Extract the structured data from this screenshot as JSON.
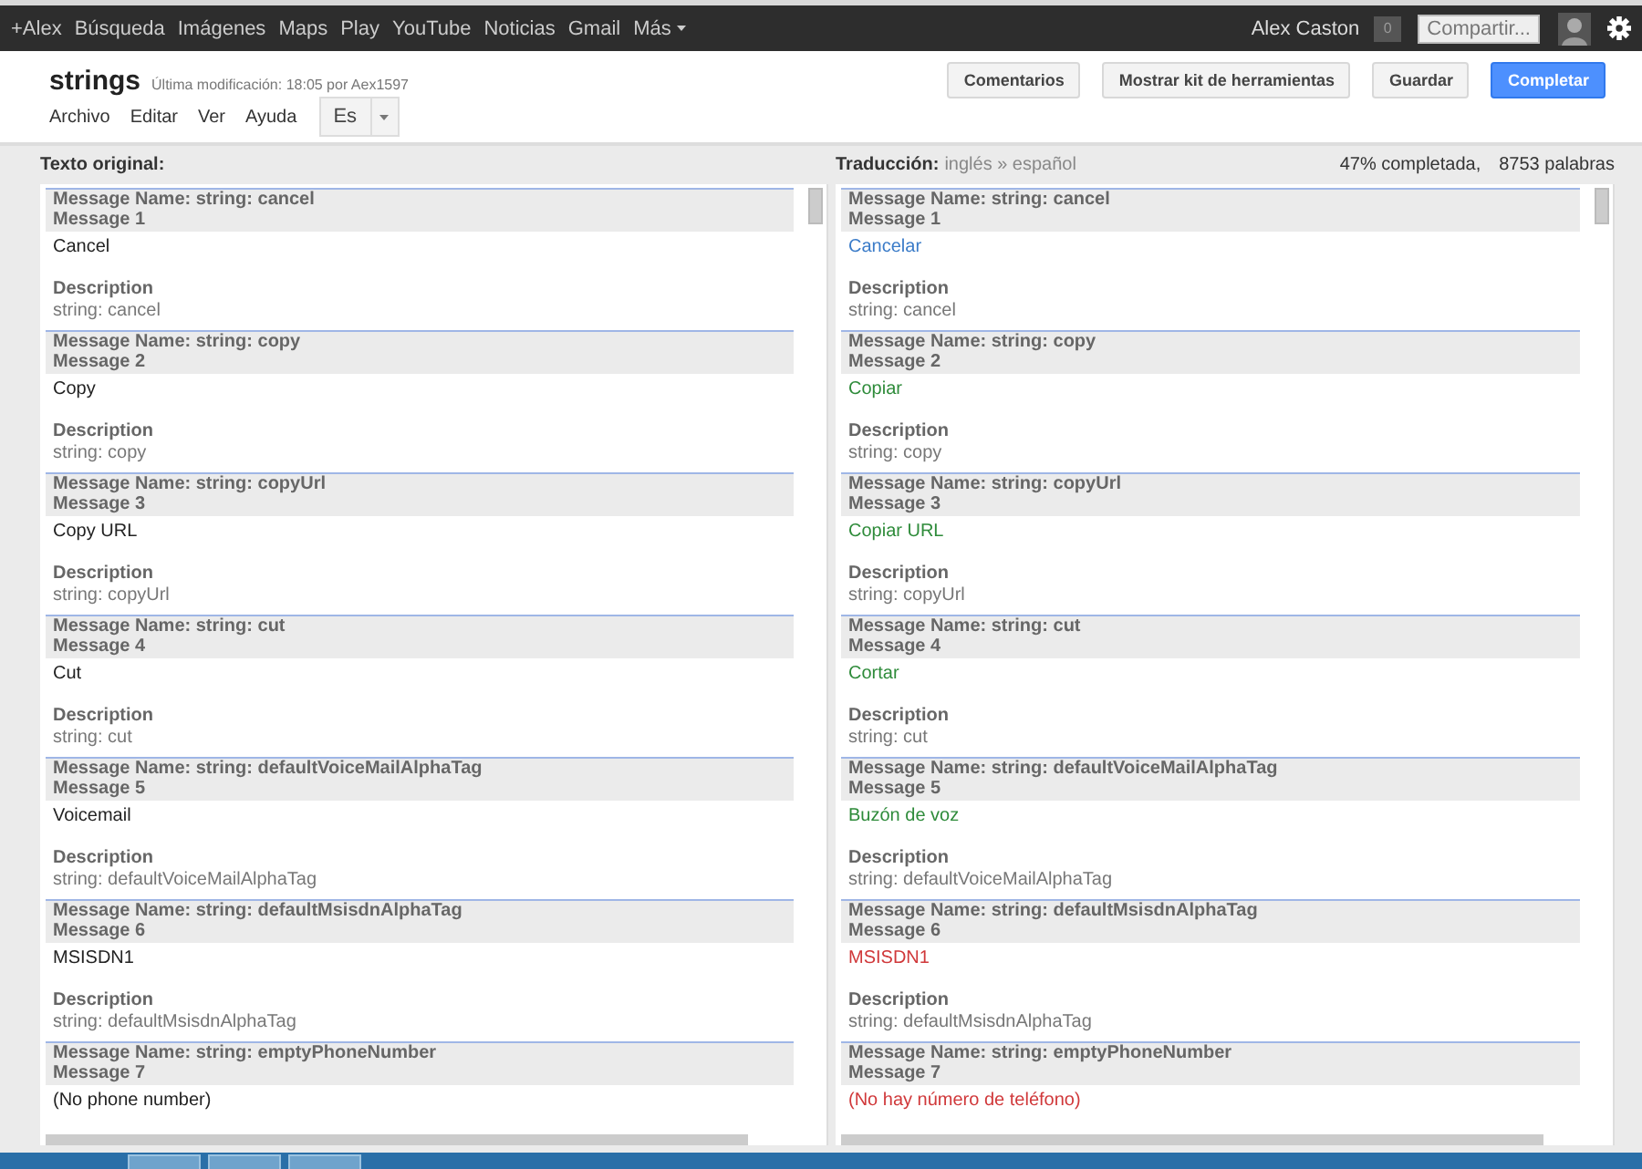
{
  "topbar": {
    "links": [
      "+Alex",
      "Búsqueda",
      "Imágenes",
      "Maps",
      "Play",
      "YouTube",
      "Noticias",
      "Gmail",
      "Más"
    ],
    "user": "Alex Caston",
    "notifications": "0",
    "share": "Compartir..."
  },
  "document": {
    "title": "strings",
    "modified": "Última modificación: 18:05 por Aex1597",
    "menu": [
      "Archivo",
      "Editar",
      "Ver",
      "Ayuda"
    ],
    "language": "Es",
    "buttons": [
      {
        "label": "Comentarios",
        "primary": false
      },
      {
        "label": "Mostrar kit de herramientas",
        "primary": false
      },
      {
        "label": "Guardar",
        "primary": false
      },
      {
        "label": "Completar",
        "primary": true
      }
    ]
  },
  "original": {
    "heading": "Texto original:",
    "messages": [
      {
        "name": "Message Name: string: cancel",
        "number": "Message 1",
        "text": "Cancel",
        "description_label": "Description",
        "description": "string: cancel"
      },
      {
        "name": "Message Name: string: copy",
        "number": "Message 2",
        "text": "Copy",
        "description_label": "Description",
        "description": "string: copy"
      },
      {
        "name": "Message Name: string: copyUrl",
        "number": "Message 3",
        "text": "Copy URL",
        "description_label": "Description",
        "description": "string: copyUrl"
      },
      {
        "name": "Message Name: string: cut",
        "number": "Message 4",
        "text": "Cut",
        "description_label": "Description",
        "description": "string: cut"
      },
      {
        "name": "Message Name: string: defaultVoiceMailAlphaTag",
        "number": "Message 5",
        "text": "Voicemail",
        "description_label": "Description",
        "description": "string: defaultVoiceMailAlphaTag"
      },
      {
        "name": "Message Name: string: defaultMsisdnAlphaTag",
        "number": "Message 6",
        "text": "MSISDN1",
        "description_label": "Description",
        "description": "string: defaultMsisdnAlphaTag"
      },
      {
        "name": "Message Name: string: emptyPhoneNumber",
        "number": "Message 7",
        "text": "(No phone number)"
      }
    ]
  },
  "translation": {
    "heading": "Traducción:",
    "languages": "inglés » español",
    "progress": "47% completada,",
    "words": "8753 palabras",
    "messages": [
      {
        "name": "Message Name: string: cancel",
        "number": "Message 1",
        "text": "Cancelar",
        "color": "#3a7bc8",
        "description_label": "Description",
        "description": "string: cancel"
      },
      {
        "name": "Message Name: string: copy",
        "number": "Message 2",
        "text": "Copiar",
        "color": "#2e8b3a",
        "description_label": "Description",
        "description": "string: copy"
      },
      {
        "name": "Message Name: string: copyUrl",
        "number": "Message 3",
        "text": "Copiar URL",
        "color": "#2e8b3a",
        "description_label": "Description",
        "description": "string: copyUrl"
      },
      {
        "name": "Message Name: string: cut",
        "number": "Message 4",
        "text": "Cortar",
        "color": "#2e8b3a",
        "description_label": "Description",
        "description": "string: cut"
      },
      {
        "name": "Message Name: string: defaultVoiceMailAlphaTag",
        "number": "Message 5",
        "text": "Buzón de voz",
        "color": "#2e8b3a",
        "description_label": "Description",
        "description": "string: defaultVoiceMailAlphaTag"
      },
      {
        "name": "Message Name: string: defaultMsisdnAlphaTag",
        "number": "Message 6",
        "text": "MSISDN1",
        "color": "#d0383a",
        "description_label": "Description",
        "description": "string: defaultMsisdnAlphaTag"
      },
      {
        "name": "Message Name: string: emptyPhoneNumber",
        "number": "Message 7",
        "text": "(No hay número de teléfono)",
        "color": "#d0383a"
      }
    ]
  }
}
